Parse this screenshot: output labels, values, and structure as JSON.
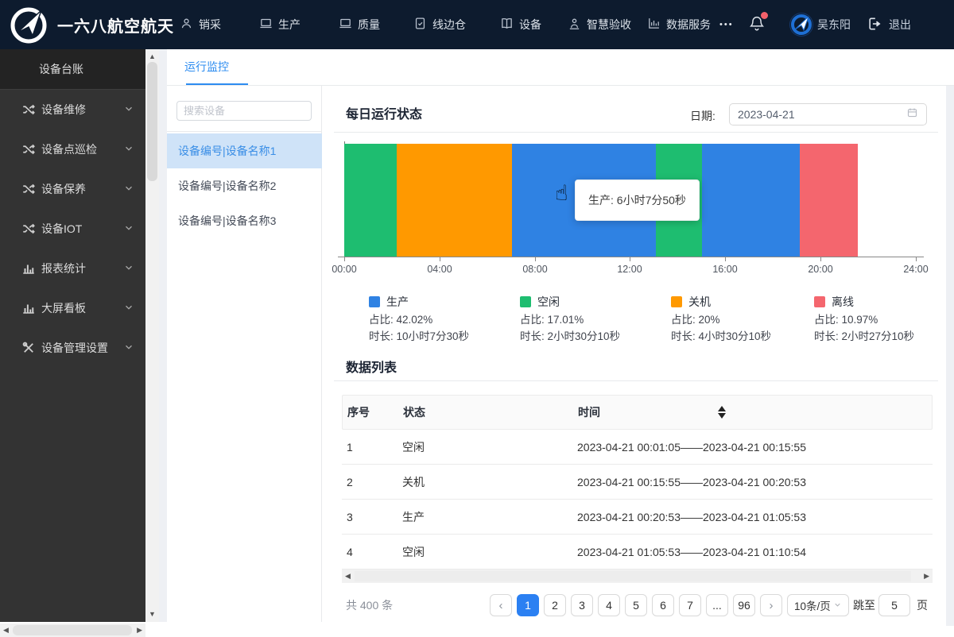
{
  "navbar": {
    "brand": "一六八航空航天",
    "items": [
      {
        "label": "销采",
        "icon": "user-icon"
      },
      {
        "label": "生产",
        "icon": "laptop-icon"
      },
      {
        "label": "质量",
        "icon": "laptop-icon"
      },
      {
        "label": "线边仓",
        "icon": "doc-check-icon"
      },
      {
        "label": "设备",
        "icon": "book-icon"
      },
      {
        "label": "智慧验收",
        "icon": "user-badge-icon"
      },
      {
        "label": "数据服务",
        "icon": "bar-chart-icon"
      }
    ],
    "more": "•••",
    "username": "吴东阳",
    "logout": "退出"
  },
  "sidebar": {
    "header": "设备台账",
    "items": [
      {
        "label": "设备维修",
        "icon": "shuffle-icon"
      },
      {
        "label": "设备点巡检",
        "icon": "shuffle-icon"
      },
      {
        "label": "设备保养",
        "icon": "shuffle-icon"
      },
      {
        "label": "设备IOT",
        "icon": "shuffle-icon"
      },
      {
        "label": "报表统计",
        "icon": "chart-icon"
      },
      {
        "label": "大屏看板",
        "icon": "chart-icon"
      },
      {
        "label": "设备管理设置",
        "icon": "tools-icon"
      }
    ]
  },
  "tabbar": {
    "active_tab": "运行监控"
  },
  "device_panel": {
    "search_placeholder": "搜索设备",
    "items": [
      "设备编号|设备名称1",
      "设备编号|设备名称2",
      "设备编号|设备名称3"
    ],
    "selected": "设备编号|设备名称1"
  },
  "monitor": {
    "title": "每日运行状态",
    "date_label": "日期:",
    "date_value": "2023-04-21",
    "tooltip_text": "生产: 6小时7分50秒"
  },
  "chart_data": {
    "type": "timeline-status-bar",
    "title": "每日运行状态",
    "x_ticks": [
      "00:00",
      "04:00",
      "08:00",
      "12:00",
      "16:00",
      "20:00",
      "24:00"
    ],
    "x_range": [
      "00:00",
      "24:00"
    ],
    "segments": [
      {
        "status": "空闲",
        "color": "#1ebd70",
        "start": "00:00",
        "end": "02:12",
        "width_pct": 9.2
      },
      {
        "status": "关机",
        "color": "#ff9900",
        "start": "02:12",
        "end": "07:03",
        "width_pct": 20.17
      },
      {
        "status": "生产",
        "color": "#2f82e3",
        "start": "07:03",
        "end": "13:05",
        "width_pct": 25.17
      },
      {
        "status": "空闲",
        "color": "#1ebd70",
        "start": "13:05",
        "end": "15:01",
        "width_pct": 8.07
      },
      {
        "status": "生产",
        "color": "#2f82e3",
        "start": "15:01",
        "end": "19:08",
        "width_pct": 17.11
      },
      {
        "status": "离线",
        "color": "#f4666e",
        "start": "19:08",
        "end": "21:34",
        "width_pct": 10.15
      }
    ],
    "legend": [
      {
        "label": "生产",
        "color": "#2f82e3",
        "ratio": "占比: 42.02%",
        "duration": "时长: 10小时7分30秒"
      },
      {
        "label": "空闲",
        "color": "#1ebd70",
        "ratio": "占比: 17.01%",
        "duration": "时长: 2小时30分10秒"
      },
      {
        "label": "关机",
        "color": "#ff9900",
        "ratio": "占比: 20%",
        "duration": "时长: 4小时30分10秒"
      },
      {
        "label": "离线",
        "color": "#f4666e",
        "ratio": "占比: 10.97%",
        "duration": "时长: 2小时27分10秒"
      }
    ]
  },
  "table": {
    "title": "数据列表",
    "columns": [
      "序号",
      "状态",
      "时间"
    ],
    "rows": [
      {
        "no": "1",
        "status": "空闲",
        "time": "2023-04-21 00:01:05——2023-04-21 00:15:55"
      },
      {
        "no": "2",
        "status": "关机",
        "time": "2023-04-21 00:15:55——2023-04-21 00:20:53"
      },
      {
        "no": "3",
        "status": "生产",
        "time": "2023-04-21 00:20:53——2023-04-21 01:05:53"
      },
      {
        "no": "4",
        "status": "空闲",
        "time": "2023-04-21 01:05:53——2023-04-21 01:10:54"
      }
    ]
  },
  "pagination": {
    "total": "共 400 条",
    "pages": [
      "1",
      "2",
      "3",
      "4",
      "5",
      "6",
      "7",
      "...",
      "96"
    ],
    "active_page": "1",
    "page_size": "10条/页",
    "jump_label": "跳至",
    "jump_value": "5",
    "jump_suffix": "页"
  },
  "colors": {
    "navbar_bg": "#0d1b2e",
    "sidebar_bg": "#333333",
    "accent_blue": "#2d8cf0",
    "selected_item_bg": "#cfe3f8",
    "status_production": "#2f82e3",
    "status_idle": "#1ebd70",
    "status_shutdown": "#ff9900",
    "status_offline": "#f4666e",
    "pagination_active": "#2b80f2",
    "notification_dot": "#f2606a"
  }
}
